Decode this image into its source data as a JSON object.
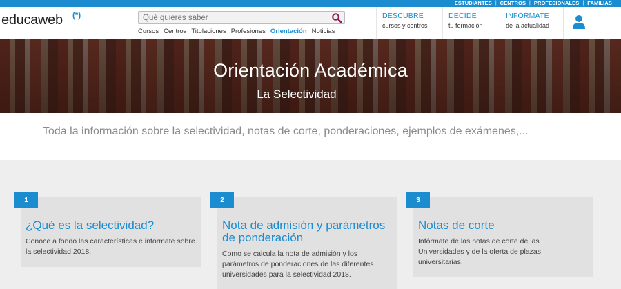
{
  "topbar": {
    "links": [
      "ESTUDIANTES",
      "CENTROS",
      "PROFESIONALES",
      "FAMILIAS"
    ]
  },
  "logo": {
    "text": "educaweb",
    "mark": "(*)"
  },
  "search": {
    "placeholder": "Qué quieres saber"
  },
  "subnav": {
    "items": [
      "Cursos",
      "Centros",
      "Titulaciones",
      "Profesiones",
      "Orientación",
      "Noticias"
    ],
    "active": "Orientación"
  },
  "header_nav": [
    {
      "title": "DESCUBRE",
      "subtitle": "cursos y centros"
    },
    {
      "title": "DECIDE",
      "subtitle": "tu formación"
    },
    {
      "title": "INFÓRMATE",
      "subtitle": "de la actualidad"
    }
  ],
  "hero": {
    "title": "Orientación Académica",
    "subtitle": "La Selectividad"
  },
  "intro": {
    "text": "Toda la información sobre la selectividad, notas de corte, ponderaciones, ejemplos de exámenes,..."
  },
  "cards": [
    {
      "number": "1",
      "title": "¿Qué es la selectividad?",
      "text": "Conoce a fondo las características e infórmate sobre la selectividad 2018."
    },
    {
      "number": "2",
      "title": "Nota de admisión y parámetros de ponderación",
      "text": "Como se calcula la nota de admisión y los parámetros de ponderaciones de las diferentes universidades para la selectividad 2018."
    },
    {
      "number": "3",
      "title": "Notas de corte",
      "text": "Infórmate de las notas de corte de las Universidades y de la oferta de plazas universitarias."
    }
  ],
  "colors": {
    "brand_blue": "#1a8ccf",
    "search_icon": "#8e1b5a"
  }
}
